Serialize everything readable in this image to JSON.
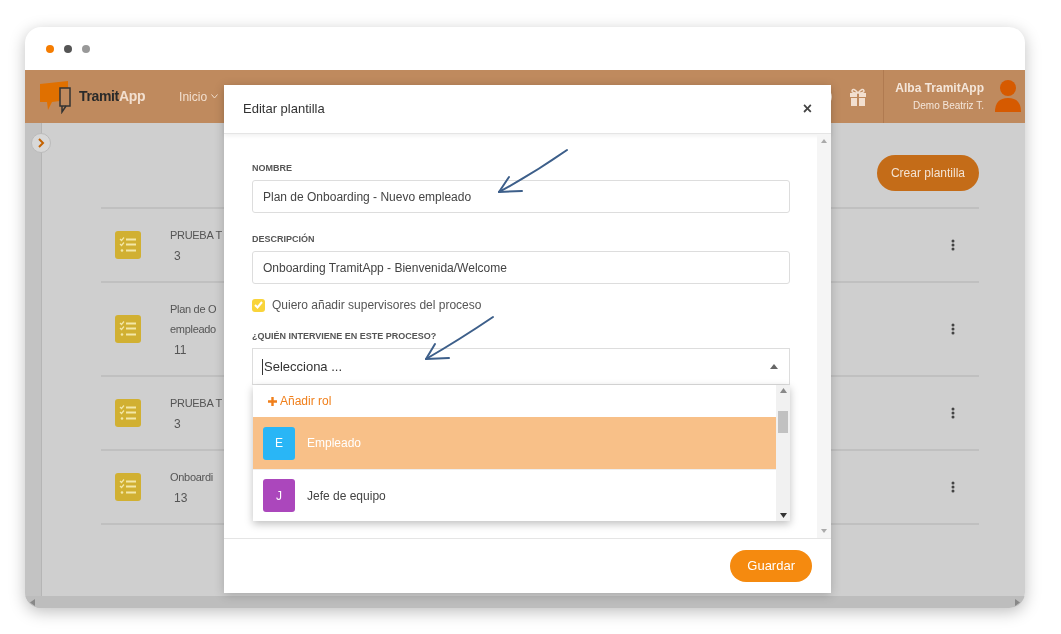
{
  "header": {
    "logo": {
      "first": "Tramit",
      "second": "App"
    },
    "nav": [
      {
        "label": "Inicio"
      }
    ],
    "user": {
      "name": "Alba TramitApp",
      "subtitle": "Demo Beatriz T."
    }
  },
  "toolbar": {
    "create_button": "Crear plantilla"
  },
  "templates": [
    {
      "title_lines": [
        "PRUEBA T"
      ],
      "count": "3"
    },
    {
      "title_lines": [
        "Plan de O",
        "empleado"
      ],
      "count": "11"
    },
    {
      "title_lines": [
        "PRUEBA T"
      ],
      "count": "3"
    },
    {
      "title_lines": [
        "Onboardi"
      ],
      "count": "13"
    }
  ],
  "modal": {
    "title": "Editar plantilla",
    "close": "×",
    "fields": [
      {
        "label": "NOMBRE",
        "value": "Plan de Onboarding - Nuevo empleado"
      },
      {
        "label": "DESCRIPCIÓN",
        "value": "Onboarding TramitApp - Bienvenida/Welcome"
      }
    ],
    "checkbox": {
      "label": "Quiero añadir supervisores del proceso",
      "checked": true
    },
    "select": {
      "label": "¿QUIÉN INTERVIENE EN ESTE PROCESO?",
      "placeholder": "Selecciona ...",
      "expanded": true
    },
    "dropdown": {
      "add_label": "Añadir rol",
      "options": [
        {
          "initial": "E",
          "label": "Empleado",
          "color": "#29b6f6",
          "selected": true
        },
        {
          "initial": "J",
          "label": "Jefe de equipo",
          "color": "#ab47bc",
          "selected": false
        }
      ]
    },
    "save_button": "Guardar"
  }
}
